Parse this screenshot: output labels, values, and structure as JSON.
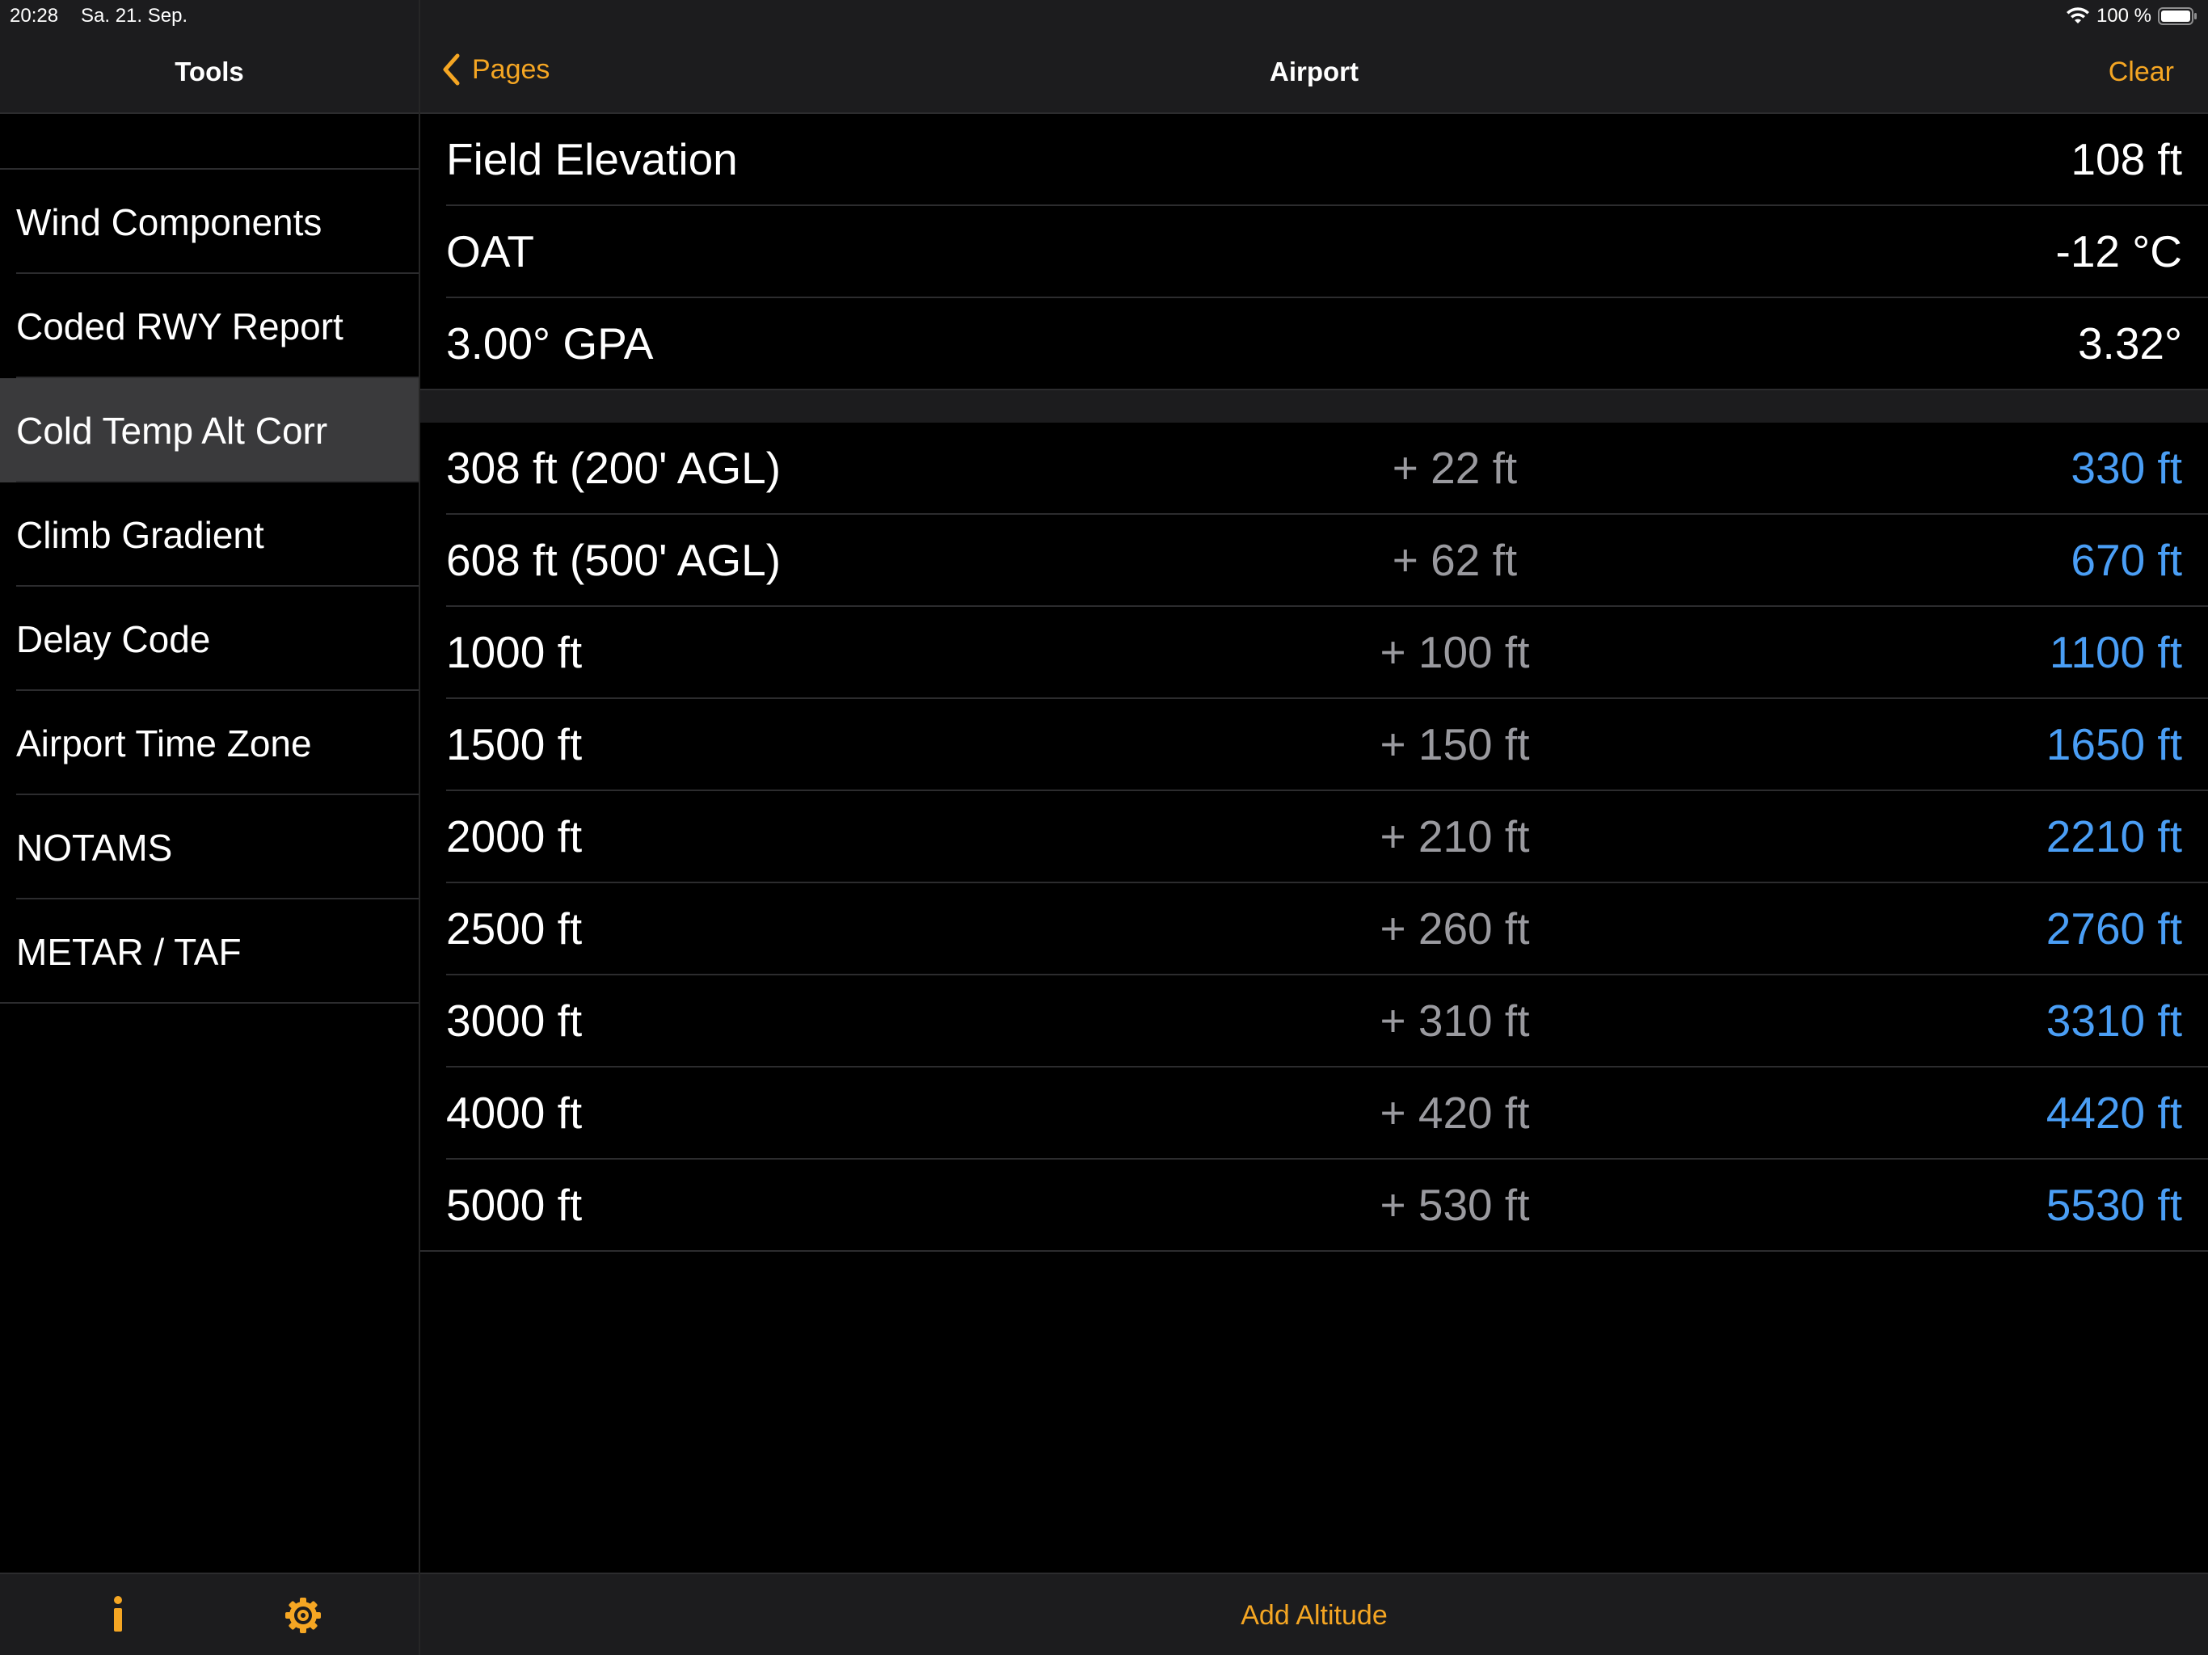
{
  "status_bar": {
    "time": "20:28",
    "date": "Sa. 21. Sep.",
    "battery": "100 %"
  },
  "sidebar": {
    "title": "Tools",
    "items": [
      {
        "label": "Wind Components"
      },
      {
        "label": "Coded RWY Report"
      },
      {
        "label": "Cold Temp Alt Corr",
        "selected": true
      },
      {
        "label": "Climb Gradient"
      },
      {
        "label": "Delay Code"
      },
      {
        "label": "Airport Time Zone"
      },
      {
        "label": "NOTAMS"
      },
      {
        "label": "METAR / TAF"
      }
    ],
    "toolbar_icons": [
      "info-icon",
      "gear-icon"
    ]
  },
  "nav": {
    "back_label": "Pages",
    "title": "Airport",
    "clear_label": "Clear"
  },
  "inputs": [
    {
      "label": "Field Elevation",
      "value": "108 ft"
    },
    {
      "label": "OAT",
      "value": "-12 °C"
    },
    {
      "label": "3.00° GPA",
      "value": "3.32°"
    }
  ],
  "results": [
    {
      "altitude": "308 ft  (200' AGL)",
      "correction": "+ 22 ft",
      "corrected": "330 ft"
    },
    {
      "altitude": "608 ft  (500' AGL)",
      "correction": "+ 62 ft",
      "corrected": "670 ft"
    },
    {
      "altitude": "1000 ft",
      "correction": "+ 100 ft",
      "corrected": "1100 ft"
    },
    {
      "altitude": "1500 ft",
      "correction": "+ 150 ft",
      "corrected": "1650 ft"
    },
    {
      "altitude": "2000 ft",
      "correction": "+ 210 ft",
      "corrected": "2210 ft"
    },
    {
      "altitude": "2500 ft",
      "correction": "+ 260 ft",
      "corrected": "2760 ft"
    },
    {
      "altitude": "3000 ft",
      "correction": "+ 310 ft",
      "corrected": "3310 ft"
    },
    {
      "altitude": "4000 ft",
      "correction": "+ 420 ft",
      "corrected": "4420 ft"
    },
    {
      "altitude": "5000 ft",
      "correction": "+ 530 ft",
      "corrected": "5530 ft"
    }
  ],
  "bottom_toolbar": {
    "add_label": "Add Altitude"
  },
  "colors": {
    "accent": "#f5a623",
    "result_blue": "#4a9ef5",
    "correction_gray": "#9a9a9f",
    "bar_background": "#1c1c1e",
    "selected_row": "#3a3a3c"
  }
}
